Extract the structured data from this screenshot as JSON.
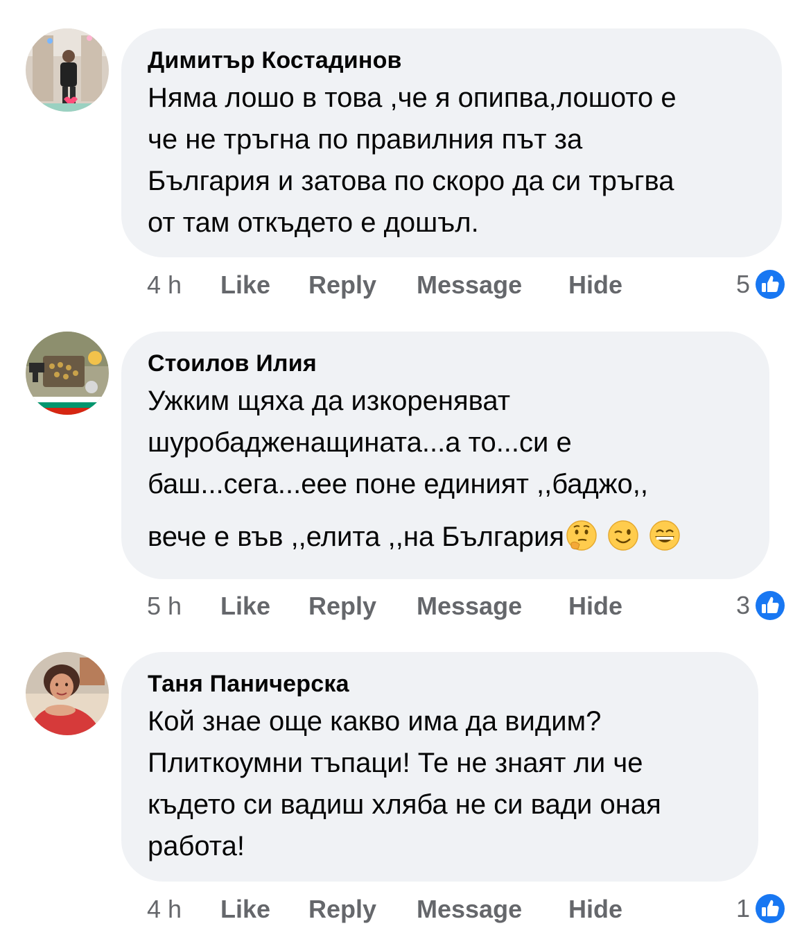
{
  "comments": [
    {
      "author": "Димитър Костадинов",
      "lines": [
        "Няма лошо в това ,че я опипва,лошото е",
        "че не тръгна по правилния път за",
        "България и затова по скоро да си тръгва",
        "от там откъдето е дошъл."
      ],
      "time": "4 h",
      "like_label": "Like",
      "reply_label": "Reply",
      "message_label": "Message",
      "hide_label": "Hide",
      "reaction_count": "5",
      "reaction_icon": "thumbs-up-icon"
    },
    {
      "author": "Стоилов Илия",
      "lines": [
        "Ужким щяха да изкореняват",
        "шуробадженащината...а то...си е",
        "баш...сега...еее поне единият ,,баджо,,",
        "вече е във ,,елита ,,на България"
      ],
      "emojis": [
        "thinking-face-icon",
        "winking-face-icon",
        "grinning-face-icon"
      ],
      "time": "5 h",
      "like_label": "Like",
      "reply_label": "Reply",
      "message_label": "Message",
      "hide_label": "Hide",
      "reaction_count": "3",
      "reaction_icon": "thumbs-up-icon"
    },
    {
      "author": "Таня Паничерска",
      "lines": [
        "Кой знае още какво има да видим?",
        "Плиткоумни тъпаци! Те не знаят ли че",
        "където си вадиш хляба не си вади оная",
        "работа!"
      ],
      "time": "4 h",
      "like_label": "Like",
      "reply_label": "Reply",
      "message_label": "Message",
      "hide_label": "Hide",
      "reaction_count": "1",
      "reaction_icon": "thumbs-up-icon"
    }
  ],
  "colors": {
    "bubble": "#f0f2f5",
    "meta_text": "#65676b",
    "like_blue": "#1877f2"
  }
}
